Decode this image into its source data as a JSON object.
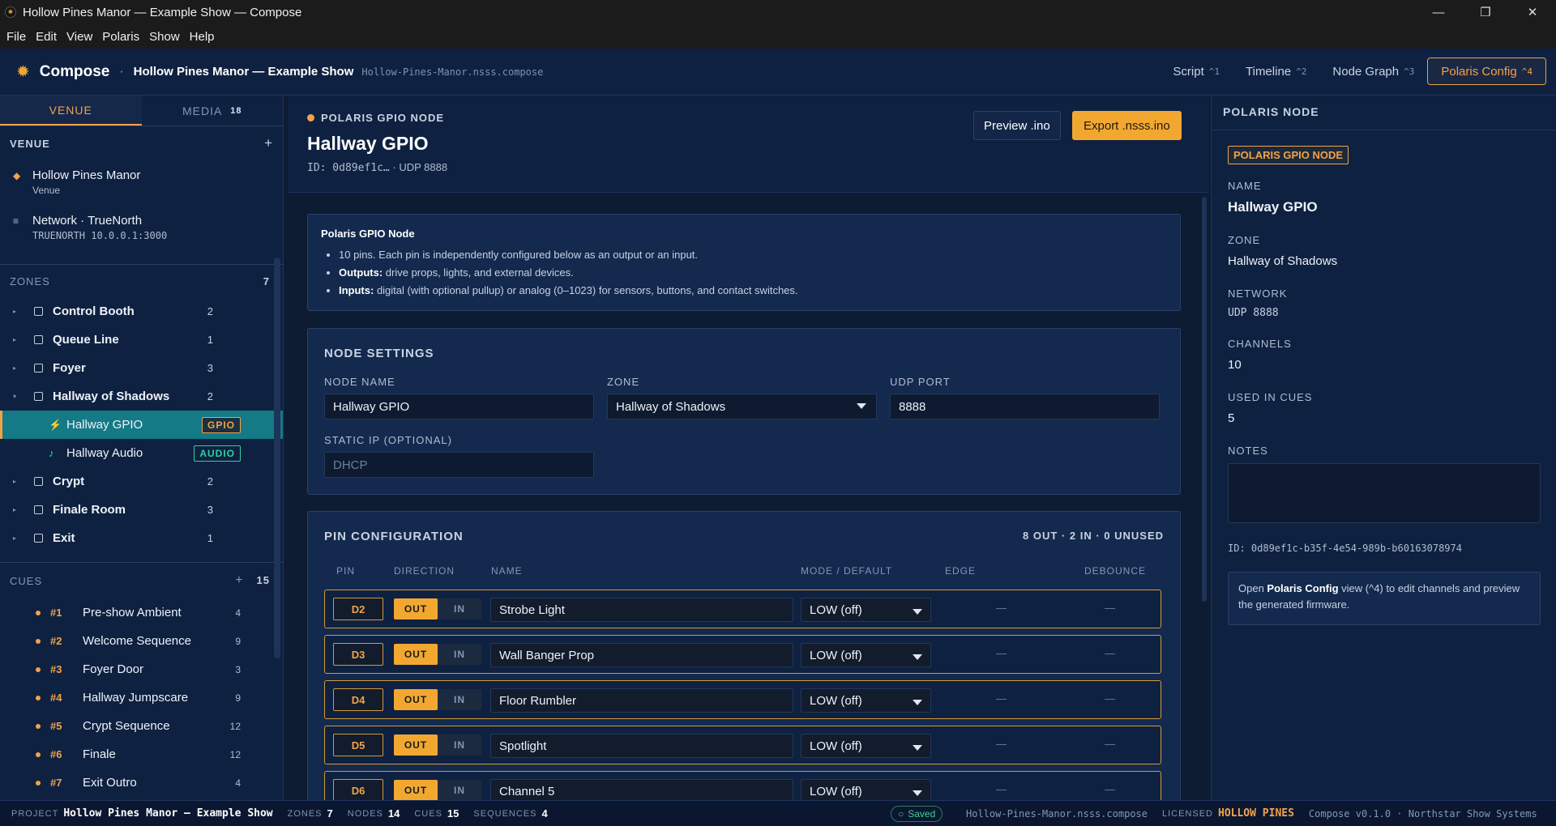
{
  "window": {
    "title": "Hollow Pines Manor — Example Show — Compose",
    "minimize": "—",
    "maximize": "❐",
    "close": "✕"
  },
  "menu": [
    "File",
    "Edit",
    "View",
    "Polaris",
    "Show",
    "Help"
  ],
  "header": {
    "brand": "Compose",
    "show_title": "Hollow Pines Manor — Example Show",
    "show_file": "Hollow-Pines-Manor.nsss.compose",
    "views": [
      {
        "label": "Script",
        "key": "^1"
      },
      {
        "label": "Timeline",
        "key": "^2"
      },
      {
        "label": "Node Graph",
        "key": "^3"
      },
      {
        "label": "Polaris Config",
        "key": "^4",
        "active": true
      }
    ]
  },
  "sidebar": {
    "tabs": [
      {
        "label": "VENUE",
        "active": true
      },
      {
        "label": "MEDIA",
        "count": "18"
      }
    ],
    "venue_heading": "VENUE",
    "add": "+",
    "venue_items": [
      {
        "icon": "◆",
        "name": "Hollow Pines Manor",
        "sub": "Venue"
      },
      {
        "icon": "≡",
        "name": "Network · TrueNorth",
        "sub": "TRUENORTH 10.0.0.1:3000"
      }
    ],
    "zones_heading": "ZONES",
    "zones_count": "7",
    "zones": [
      {
        "name": "Control Booth",
        "count": "2"
      },
      {
        "name": "Queue Line",
        "count": "1"
      },
      {
        "name": "Foyer",
        "count": "3"
      },
      {
        "name": "Hallway of Shadows",
        "count": "2",
        "expanded": true,
        "nodes": [
          {
            "name": "Hallway GPIO",
            "tag": "GPIO",
            "icon": "⚡"
          },
          {
            "name": "Hallway Audio",
            "tag": "AUDIO",
            "icon": "♪"
          }
        ]
      },
      {
        "name": "Crypt",
        "count": "2"
      },
      {
        "name": "Finale Room",
        "count": "3"
      },
      {
        "name": "Exit",
        "count": "1"
      }
    ],
    "cues_heading": "CUES",
    "cues_count": "15",
    "cues": [
      {
        "num": "#1",
        "name": "Pre-show Ambient",
        "count": "4"
      },
      {
        "num": "#2",
        "name": "Welcome Sequence",
        "count": "9"
      },
      {
        "num": "#3",
        "name": "Foyer Door",
        "count": "3"
      },
      {
        "num": "#4",
        "name": "Hallway Jumpscare",
        "count": "9"
      },
      {
        "num": "#5",
        "name": "Crypt Sequence",
        "count": "12"
      },
      {
        "num": "#6",
        "name": "Finale",
        "count": "12"
      },
      {
        "num": "#7",
        "name": "Exit Outro",
        "count": "4"
      }
    ]
  },
  "main": {
    "kicker": "POLARIS GPIO NODE",
    "title": "Hallway GPIO",
    "id_line": "ID: 0d89ef1c…",
    "udp_line": "· UDP 8888",
    "preview_button": "Preview .ino",
    "export_button": "Export .nsss.ino",
    "info": {
      "title": "Polaris GPIO Node",
      "line1": "10 pins. Each pin is independently configured below as an output or an input.",
      "line2_bold": "Outputs:",
      "line2": " drive props, lights, and external devices.",
      "line3_bold": "Inputs:",
      "line3": " digital (with optional pullup) or analog (0–1023) for sensors, buttons, and contact switches."
    },
    "settings": {
      "title": "NODE SETTINGS",
      "node_name_label": "NODE NAME",
      "node_name": "Hallway GPIO",
      "zone_label": "ZONE",
      "zone": "Hallway of Shadows",
      "udp_label": "UDP PORT",
      "udp": "8888",
      "static_ip_label": "STATIC IP (OPTIONAL)",
      "static_ip_placeholder": "DHCP"
    },
    "pins": {
      "title": "PIN CONFIGURATION",
      "summary": "8 OUT · 2 IN · 0 UNUSED",
      "columns": [
        "PIN",
        "DIRECTION",
        "NAME",
        "MODE / DEFAULT",
        "EDGE",
        "DEBOUNCE"
      ],
      "out_label": "OUT",
      "in_label": "IN",
      "dash": "—",
      "rows": [
        {
          "pin": "D2",
          "name": "Strobe Light",
          "mode": "LOW (off)"
        },
        {
          "pin": "D3",
          "name": "Wall Banger Prop",
          "mode": "LOW (off)"
        },
        {
          "pin": "D4",
          "name": "Floor Rumbler",
          "mode": "LOW (off)"
        },
        {
          "pin": "D5",
          "name": "Spotlight",
          "mode": "LOW (off)"
        },
        {
          "pin": "D6",
          "name": "Channel 5",
          "mode": "LOW (off)"
        }
      ]
    }
  },
  "right": {
    "heading": "POLARIS NODE",
    "tag": "POLARIS GPIO NODE",
    "name_label": "NAME",
    "name": "Hallway GPIO",
    "zone_label": "ZONE",
    "zone": "Hallway of Shadows",
    "network_label": "NETWORK",
    "network": "UDP 8888",
    "channels_label": "CHANNELS",
    "channels": "10",
    "used_label": "USED IN CUES",
    "used": "5",
    "notes_label": "NOTES",
    "id": "ID: 0d89ef1c-b35f-4e54-989b-b60163078974",
    "info_pre": "Open ",
    "info_bold": "Polaris Config",
    "info_post": " view (^4) to edit channels and preview the generated firmware."
  },
  "status": {
    "project_label": "PROJECT",
    "project": "Hollow Pines Manor — Example Show",
    "zones_label": "ZONES",
    "zones": "7",
    "nodes_label": "NODES",
    "nodes": "14",
    "cues_label": "CUES",
    "cues": "15",
    "sequences_label": "SEQUENCES",
    "sequences": "4",
    "saved": "Saved",
    "file": "Hollow-Pines-Manor.nsss.compose",
    "licensed_label": "LICENSED",
    "licensed": "HOLLOW PINES",
    "version": "Compose v0.1.0 · Northstar Show Systems"
  }
}
